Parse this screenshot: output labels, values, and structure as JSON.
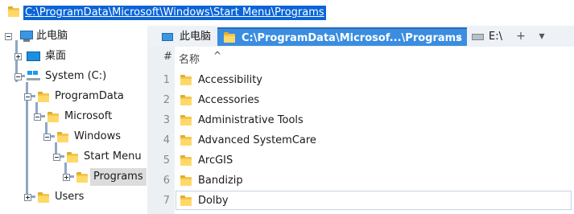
{
  "address_bar": {
    "path": "C:\\ProgramData\\Microsoft\\Windows\\Start Menu\\Programs"
  },
  "tree": {
    "items": [
      {
        "label": "此电脑",
        "icon": "computer-icon"
      },
      {
        "label": "桌面",
        "icon": "desktop-icon"
      },
      {
        "label": "System (C:)",
        "icon": "drive-icon"
      },
      {
        "label": "ProgramData",
        "icon": "folder-icon"
      },
      {
        "label": "Microsoft",
        "icon": "folder-icon"
      },
      {
        "label": "Windows",
        "icon": "folder-icon"
      },
      {
        "label": "Start Menu",
        "icon": "folder-icon"
      },
      {
        "label": "Programs",
        "icon": "folder-icon"
      },
      {
        "label": "Users",
        "icon": "folder-icon"
      }
    ]
  },
  "tabs": [
    {
      "label": "此电脑",
      "icon": "computer-icon"
    },
    {
      "label": "C:\\ProgramData\\Microsof...\\Programs",
      "icon": "folder-icon",
      "close": "×"
    },
    {
      "label": "E:\\",
      "icon": "drive-icon"
    }
  ],
  "tab_controls": {
    "add": "+",
    "dropdown": "▾"
  },
  "list": {
    "header_num": "#",
    "header_name": "名称",
    "sort_indicator": "^",
    "rows": [
      {
        "num": "1",
        "name": "Accessibility"
      },
      {
        "num": "2",
        "name": "Accessories"
      },
      {
        "num": "3",
        "name": "Administrative Tools"
      },
      {
        "num": "4",
        "name": "Advanced SystemCare"
      },
      {
        "num": "5",
        "name": "ArcGIS"
      },
      {
        "num": "6",
        "name": "Bandizip"
      },
      {
        "num": "7",
        "name": "Dolby"
      }
    ]
  },
  "colors": {
    "selection_blue": "#0a64d6",
    "active_tab": "#3a8de0",
    "folder_yellow": "#f4c64a"
  }
}
